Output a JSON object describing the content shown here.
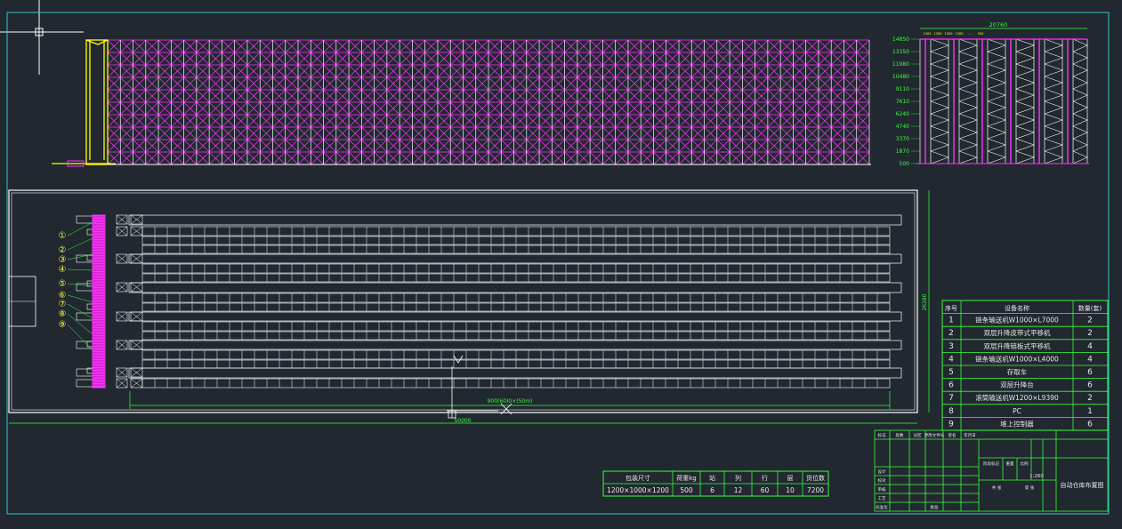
{
  "colors": {
    "background": "#212830",
    "frame": "#2fc7c7",
    "rack_upright": "#ffffff",
    "rack_brace": "#ff33ff",
    "lift": "#ffff00",
    "table_line": "#39ff39",
    "table_text": "#ffffff"
  },
  "elevation": {
    "overall_width": "20760",
    "level_heights": [
      "14850",
      "13350",
      "11980",
      "10480",
      "9110",
      "7610",
      "6240",
      "4740",
      "3370",
      "1870",
      "500"
    ],
    "top_dims": [
      "1300",
      "1300",
      "1300",
      "1300",
      "...",
      "300"
    ]
  },
  "plan": {
    "overall_length": "50000",
    "overall_width": "26280",
    "rack_length_note": "900(60)0×(50m)",
    "callouts": [
      "①",
      "②",
      "③",
      "④",
      "⑤",
      "⑥",
      "⑦",
      "⑧",
      "⑨"
    ]
  },
  "equipment_table": {
    "headers": [
      "序号",
      "设备名称",
      "数量(套)"
    ],
    "rows": [
      [
        "1",
        "链条输送机W1000×L7000",
        "2"
      ],
      [
        "2",
        "双层升降皮带式平移机",
        "2"
      ],
      [
        "3",
        "双层升降链板式平移机",
        "4"
      ],
      [
        "4",
        "链条输送机W1000×L4000",
        "4"
      ],
      [
        "5",
        "存取车",
        "6"
      ],
      [
        "6",
        "双层升降台",
        "6"
      ],
      [
        "7",
        "滚筒输送机W1200×L9390",
        "2"
      ],
      [
        "8",
        "PC",
        "1"
      ],
      [
        "9",
        "堆上控制器",
        "6"
      ]
    ]
  },
  "spec_table": {
    "headers": [
      "包装尺寸",
      "荷重kg",
      "站",
      "列",
      "行",
      "层",
      "货位数"
    ],
    "row": [
      "1200×1000×1200",
      "500",
      "6",
      "12",
      "60",
      "10",
      "7200"
    ]
  },
  "title_block": {
    "header_cells": [
      "标记",
      "处数",
      "分区",
      "更改文件号",
      "签名",
      "年月日"
    ],
    "left_rows": [
      "设计",
      "校对",
      "审核",
      "工艺",
      "标准化",
      "批准"
    ],
    "cells": [
      "阶段标记",
      "重量",
      "比例",
      "共 张",
      "第 张"
    ],
    "scale": "1:260",
    "drawing_title": "自动仓库布置图"
  }
}
